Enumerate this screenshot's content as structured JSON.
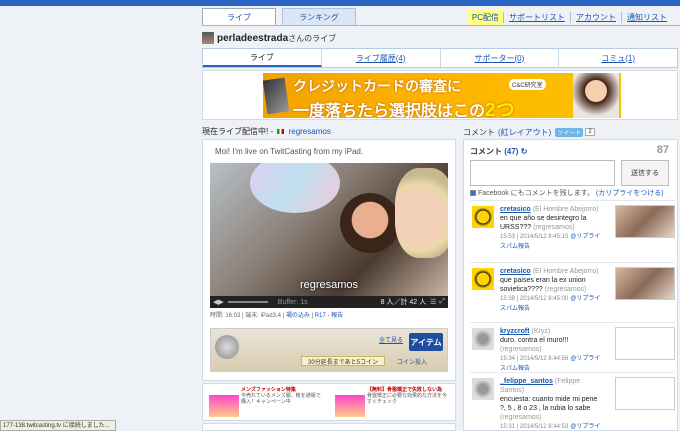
{
  "nav": {
    "tabs": [
      "ライブ",
      "ランキング"
    ],
    "links": [
      "PC配信",
      "サポートリスト",
      "アカウント",
      "通知リスト"
    ]
  },
  "user": {
    "name": "perladeestrada",
    "suffix": "さんのライブ"
  },
  "subtabs": [
    "ライブ",
    "ライブ履歴(4)",
    "サポーター(0)",
    "コミュ(1)"
  ],
  "banner": {
    "line1": "クレジットカードの審査に",
    "line2a": "一度落ちたら選択肢はこの",
    "line2b": "2つ",
    "logo": "C&C研究室"
  },
  "live": {
    "header_prefix": "現在ライブ配信中! -",
    "header_link": "regresamos",
    "intro": "Moi! I'm live on TwitCasting from my iPad.",
    "video_title": "regresamos",
    "buffer": "Buffer: 1s",
    "viewers": "8 人／計 42 人",
    "meta_time": "時間: 16:03",
    "meta_device": "端末: iPad3,4",
    "meta_report": "場の込み",
    "meta_rating": "R17 - 報告",
    "item_link": "全て見る",
    "item_button": "アイテム",
    "item_note": "30分延長まであと5コイン",
    "coin_button": "コイン投入"
  },
  "ads": [
    {
      "title": "メンズファッション特集",
      "text": "今売れているメンズ服、靴を通販で購入！キャンペーン中"
    },
    {
      "title": "【無料】骨盤矯正で失敗しない為",
      "text": "骨盤矯正に必要な効果的な方法を今すぐチェック"
    }
  ],
  "comments_header": {
    "label": "コメント",
    "link": "(紅レイアウト)",
    "tweet": "ツイート",
    "tweet_count": "2"
  },
  "comments_box": {
    "label": "コメント",
    "count": "(47)",
    "total": "87",
    "send": "送信する",
    "fb_text": "Facebook にもコメントを残します。",
    "fb_link": "(カリプライをつける)"
  },
  "comments": [
    {
      "user": "cretasico",
      "nick": "(El Hombre Abejorro)",
      "text": "en que año se desintegro la URSS???",
      "tag": "(regresamos)",
      "time": "15:53 | 2014/5/12 8:45:15",
      "action": "@リプライ スパム報告"
    },
    {
      "user": "cretasico",
      "nick": "(El Hombre Abejorro)",
      "text": "que paises eran la ex union sovietica????",
      "tag": "(regresamos)",
      "time": "15:38 | 2014/5/12 8:45:00",
      "action": "@リプライ スパム報告"
    },
    {
      "user": "kryzcroft",
      "nick": "(Kryz)",
      "text": "duro. contra el muro!!!",
      "tag": "(regresamos)",
      "time": "15:34 | 2014/5/12 8:44:56",
      "action": "@リプライ スパム報告"
    },
    {
      "user": "_felippe_santos",
      "nick": "(Felippe Santos)",
      "text": "encuesta: cuanto mide mi pene ?, 5 , 8 o 23 , la rubia lo sabe",
      "tag": "(regresamos)",
      "time": "15:31 | 2014/5/12 8:44:53",
      "action": "@リプライ"
    }
  ],
  "status": "177-138.twitcasting.tv に接続しました..."
}
